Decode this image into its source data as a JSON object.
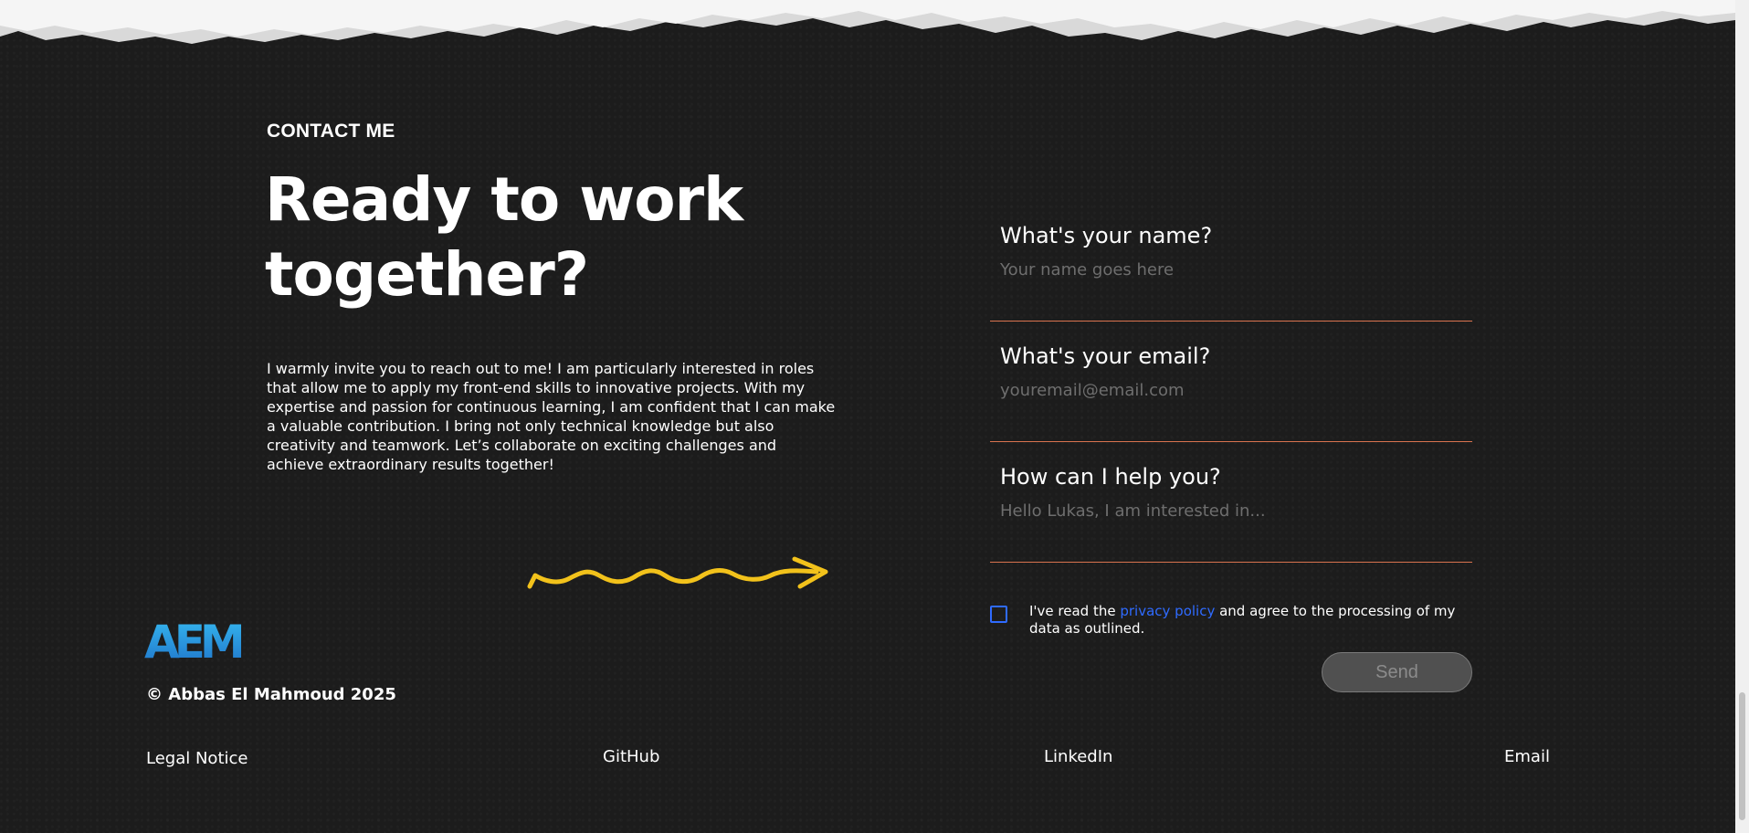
{
  "contact": {
    "eyebrow": "CONTACT ME",
    "headline_line1": "Ready to work",
    "headline_line2": "together?",
    "intro": "I warmly invite you to reach out to me! I am particularly interested in roles that allow me to apply my front-end skills to innovative projects. With my expertise and passion for continuous learning, I am confident that I can make a valuable contribution. I bring not only technical knowledge but also creativity and teamwork. Let’s collaborate on exciting challenges and achieve extraordinary results together!"
  },
  "form": {
    "name": {
      "label": "What's your name?",
      "placeholder": "Your name goes here",
      "value": ""
    },
    "email": {
      "label": "What's your email?",
      "placeholder": "youremail@email.com",
      "value": ""
    },
    "help": {
      "label": "How can I help you?",
      "placeholder": "Hello Lukas, I am interested in...",
      "value": ""
    },
    "consent": {
      "checked": false,
      "prefix": "I've read the ",
      "link": "privacy policy",
      "suffix": " and agree to the processing of my data as outlined."
    },
    "send_label": "Send"
  },
  "footer": {
    "logo_text": "AEM",
    "copyright": "© Abbas El Mahmoud 2025",
    "links": {
      "legal": "Legal Notice",
      "github": "GitHub",
      "linkedin": "LinkedIn",
      "email": "Email"
    }
  },
  "colors": {
    "background": "#1c1c1c",
    "accent_underline": "#d9734f",
    "link_blue": "#2f6bff",
    "squiggle_yellow": "#f2c21b",
    "logo_blue": "#29a9e8"
  },
  "icons": {
    "squiggle_arrow": "squiggle-arrow-icon",
    "checkbox": "checkbox-icon"
  }
}
